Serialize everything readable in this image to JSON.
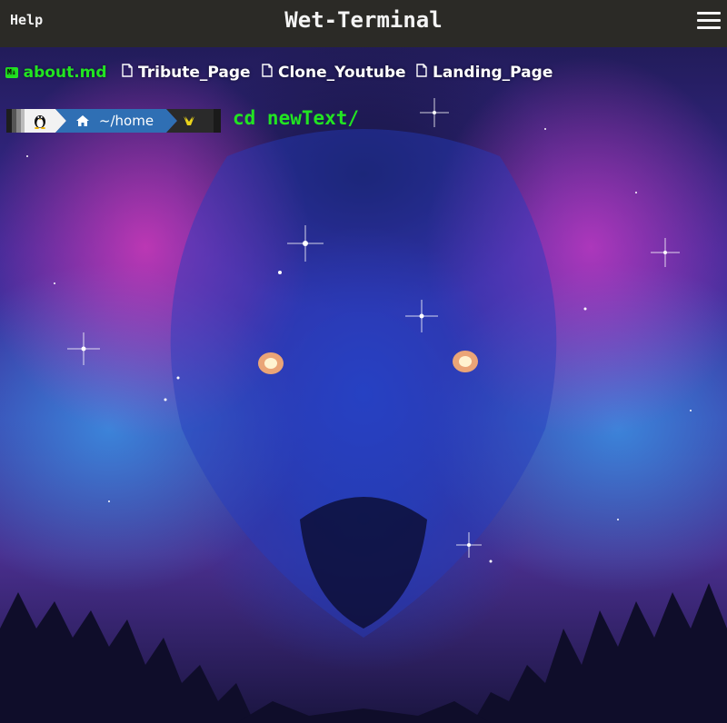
{
  "header": {
    "help_label": "Help",
    "title": "Wet-Terminal",
    "menu_icon": "hamburger-menu-icon"
  },
  "tabs": [
    {
      "label": "about.md",
      "icon": "markdown-icon",
      "active": true
    },
    {
      "label": "Tribute_Page",
      "icon": "file-icon",
      "active": false
    },
    {
      "label": "Clone_Youtube",
      "icon": "file-icon",
      "active": false
    },
    {
      "label": "Landing_Page",
      "icon": "file-icon",
      "active": false
    }
  ],
  "prompt": {
    "os_icon": "linux-penguin-icon",
    "home_icon": "home-icon",
    "path": "~/home",
    "status_icon": "yellow-glyph-icon",
    "command": "cd newText/"
  },
  "colors": {
    "header_bg": "#2b2a26",
    "accent_green": "#22e422",
    "prompt_blue": "#2f6fb4",
    "prompt_dark": "#2a2a2a"
  },
  "background": {
    "description_icon": "galaxy-wolf-wallpaper"
  }
}
